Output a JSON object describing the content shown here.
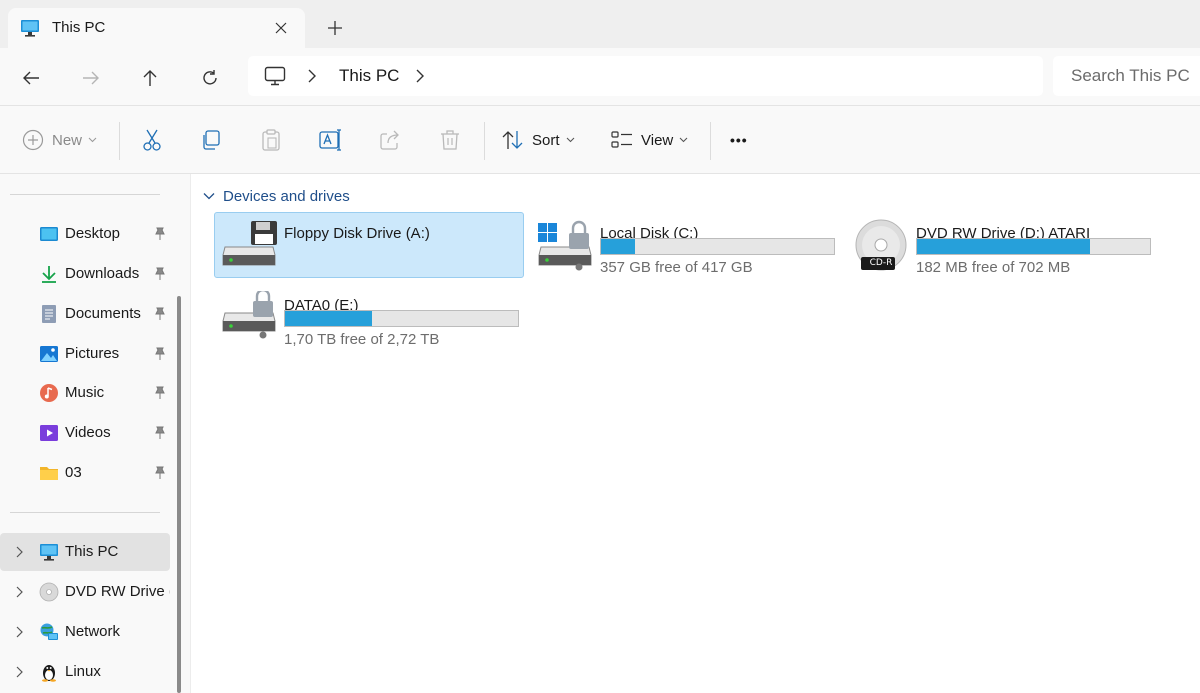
{
  "tab": {
    "title": "This PC"
  },
  "address": {
    "crumbs": [
      "This PC"
    ]
  },
  "search": {
    "placeholder": "Search This PC"
  },
  "toolbar": {
    "new_label": "New",
    "sort_label": "Sort",
    "view_label": "View",
    "more_label": "•••"
  },
  "sidebar": {
    "quick_access": [
      {
        "label": "Desktop",
        "icon": "desktop-icon"
      },
      {
        "label": "Downloads",
        "icon": "downloads-icon"
      },
      {
        "label": "Documents",
        "icon": "documents-icon"
      },
      {
        "label": "Pictures",
        "icon": "pictures-icon"
      },
      {
        "label": "Music",
        "icon": "music-icon"
      },
      {
        "label": "Videos",
        "icon": "videos-icon"
      },
      {
        "label": "03",
        "icon": "folder-icon"
      }
    ],
    "tree": [
      {
        "label": "This PC",
        "icon": "computer-icon"
      },
      {
        "label": "DVD RW Drive (",
        "icon": "dvd-icon"
      },
      {
        "label": "Network",
        "icon": "network-icon"
      },
      {
        "label": "Linux",
        "icon": "linux-icon"
      }
    ]
  },
  "main": {
    "section_title": "Devices and drives",
    "drives": [
      {
        "name": "Floppy Disk Drive (A:)",
        "icon": "floppy-drive-icon"
      },
      {
        "name": "Local Disk (C:)",
        "free_text": "357 GB free of 417 GB",
        "used_fraction": 0.144,
        "icon": "system-drive-icon"
      },
      {
        "name": "DVD RW Drive (D:) ATARI",
        "free_text": "182 MB free of 702 MB",
        "used_fraction": 0.741,
        "icon": "dvd-drive-icon",
        "disc_label": "CD-R"
      },
      {
        "name": "DATA0 (E:)",
        "free_text": "1,70 TB free of 2,72 TB",
        "used_fraction": 0.375,
        "icon": "locked-drive-icon"
      }
    ]
  },
  "colors": {
    "accent": "#26a0da",
    "selection": "#cce8fb",
    "section": "#1f4e8a"
  }
}
